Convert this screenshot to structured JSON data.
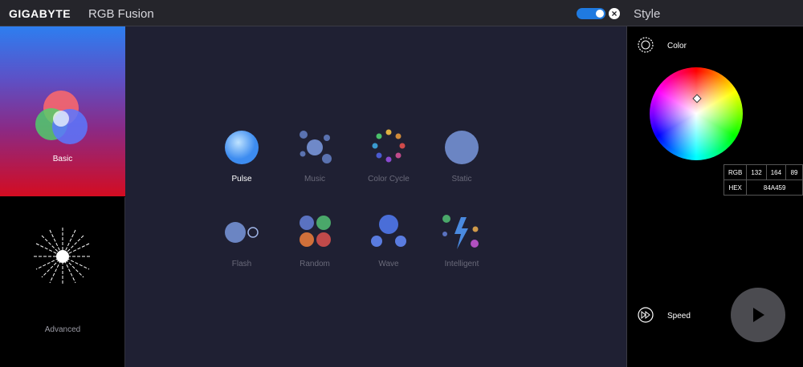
{
  "titlebar": {
    "brand": "GIGABYTE",
    "title": "RGB Fusion",
    "toggle_on": true
  },
  "nav": {
    "basic": "Basic",
    "advanced": "Advanced"
  },
  "modes": [
    {
      "label": "Pulse",
      "active": true
    },
    {
      "label": "Music",
      "active": false
    },
    {
      "label": "Color Cycle",
      "active": false
    },
    {
      "label": "Static",
      "active": false
    },
    {
      "label": "Flash",
      "active": false
    },
    {
      "label": "Random",
      "active": false
    },
    {
      "label": "Wave",
      "active": false
    },
    {
      "label": "Intelligent",
      "active": false
    }
  ],
  "style": {
    "title": "Style",
    "color_label": "Color",
    "speed_label": "Speed",
    "rgb_label": "RGB",
    "r": "132",
    "g": "164",
    "b": "89",
    "hex_label": "HEX",
    "hex": "84A459"
  }
}
